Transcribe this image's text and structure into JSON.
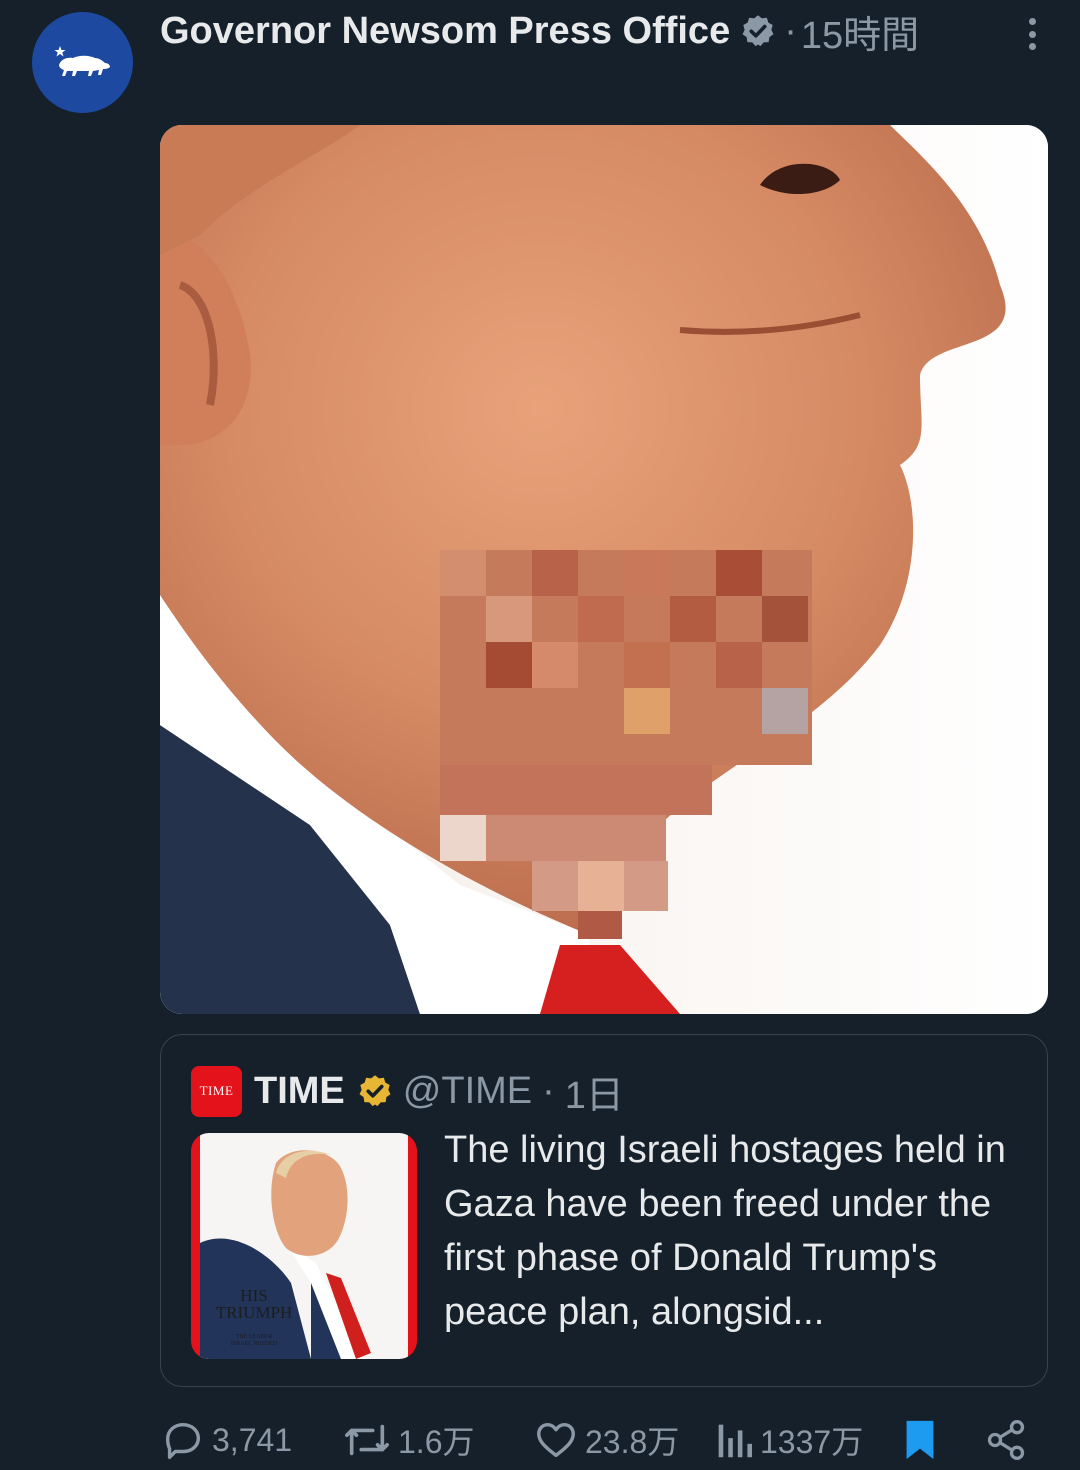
{
  "post": {
    "author_name": "Governor Newsom Press Office",
    "verified_icon": "verified-check-icon",
    "separator": "·",
    "time": "15時間",
    "avatar_icon": "california-bear-icon",
    "media_icon": "photo-icon"
  },
  "quote": {
    "logo_text": "TIME",
    "name": "TIME",
    "handle": "@TIME",
    "separator": "·",
    "time": "1日",
    "text": "The living Israeli hostages held in Gaza have been freed under the first phase of Donald Trump's peace plan, alongsid...",
    "cover": {
      "title_line1": "HIS",
      "title_line2": "TRIUMPH",
      "sub_line1": "THE LEADER",
      "sub_line2": "ISRAEL NEEDED"
    }
  },
  "actions": {
    "replies": "3,741",
    "reposts": "1.6万",
    "likes": "23.8万",
    "views": "1337万"
  },
  "colors": {
    "background": "#15202b",
    "text_primary": "#e7e9ea",
    "text_secondary": "#8b98a5",
    "verified_blue": "#8b98a5",
    "verified_gold": "#e7b634",
    "time_red": "#e3121b",
    "bookmark_blue": "#1d9bf0"
  }
}
